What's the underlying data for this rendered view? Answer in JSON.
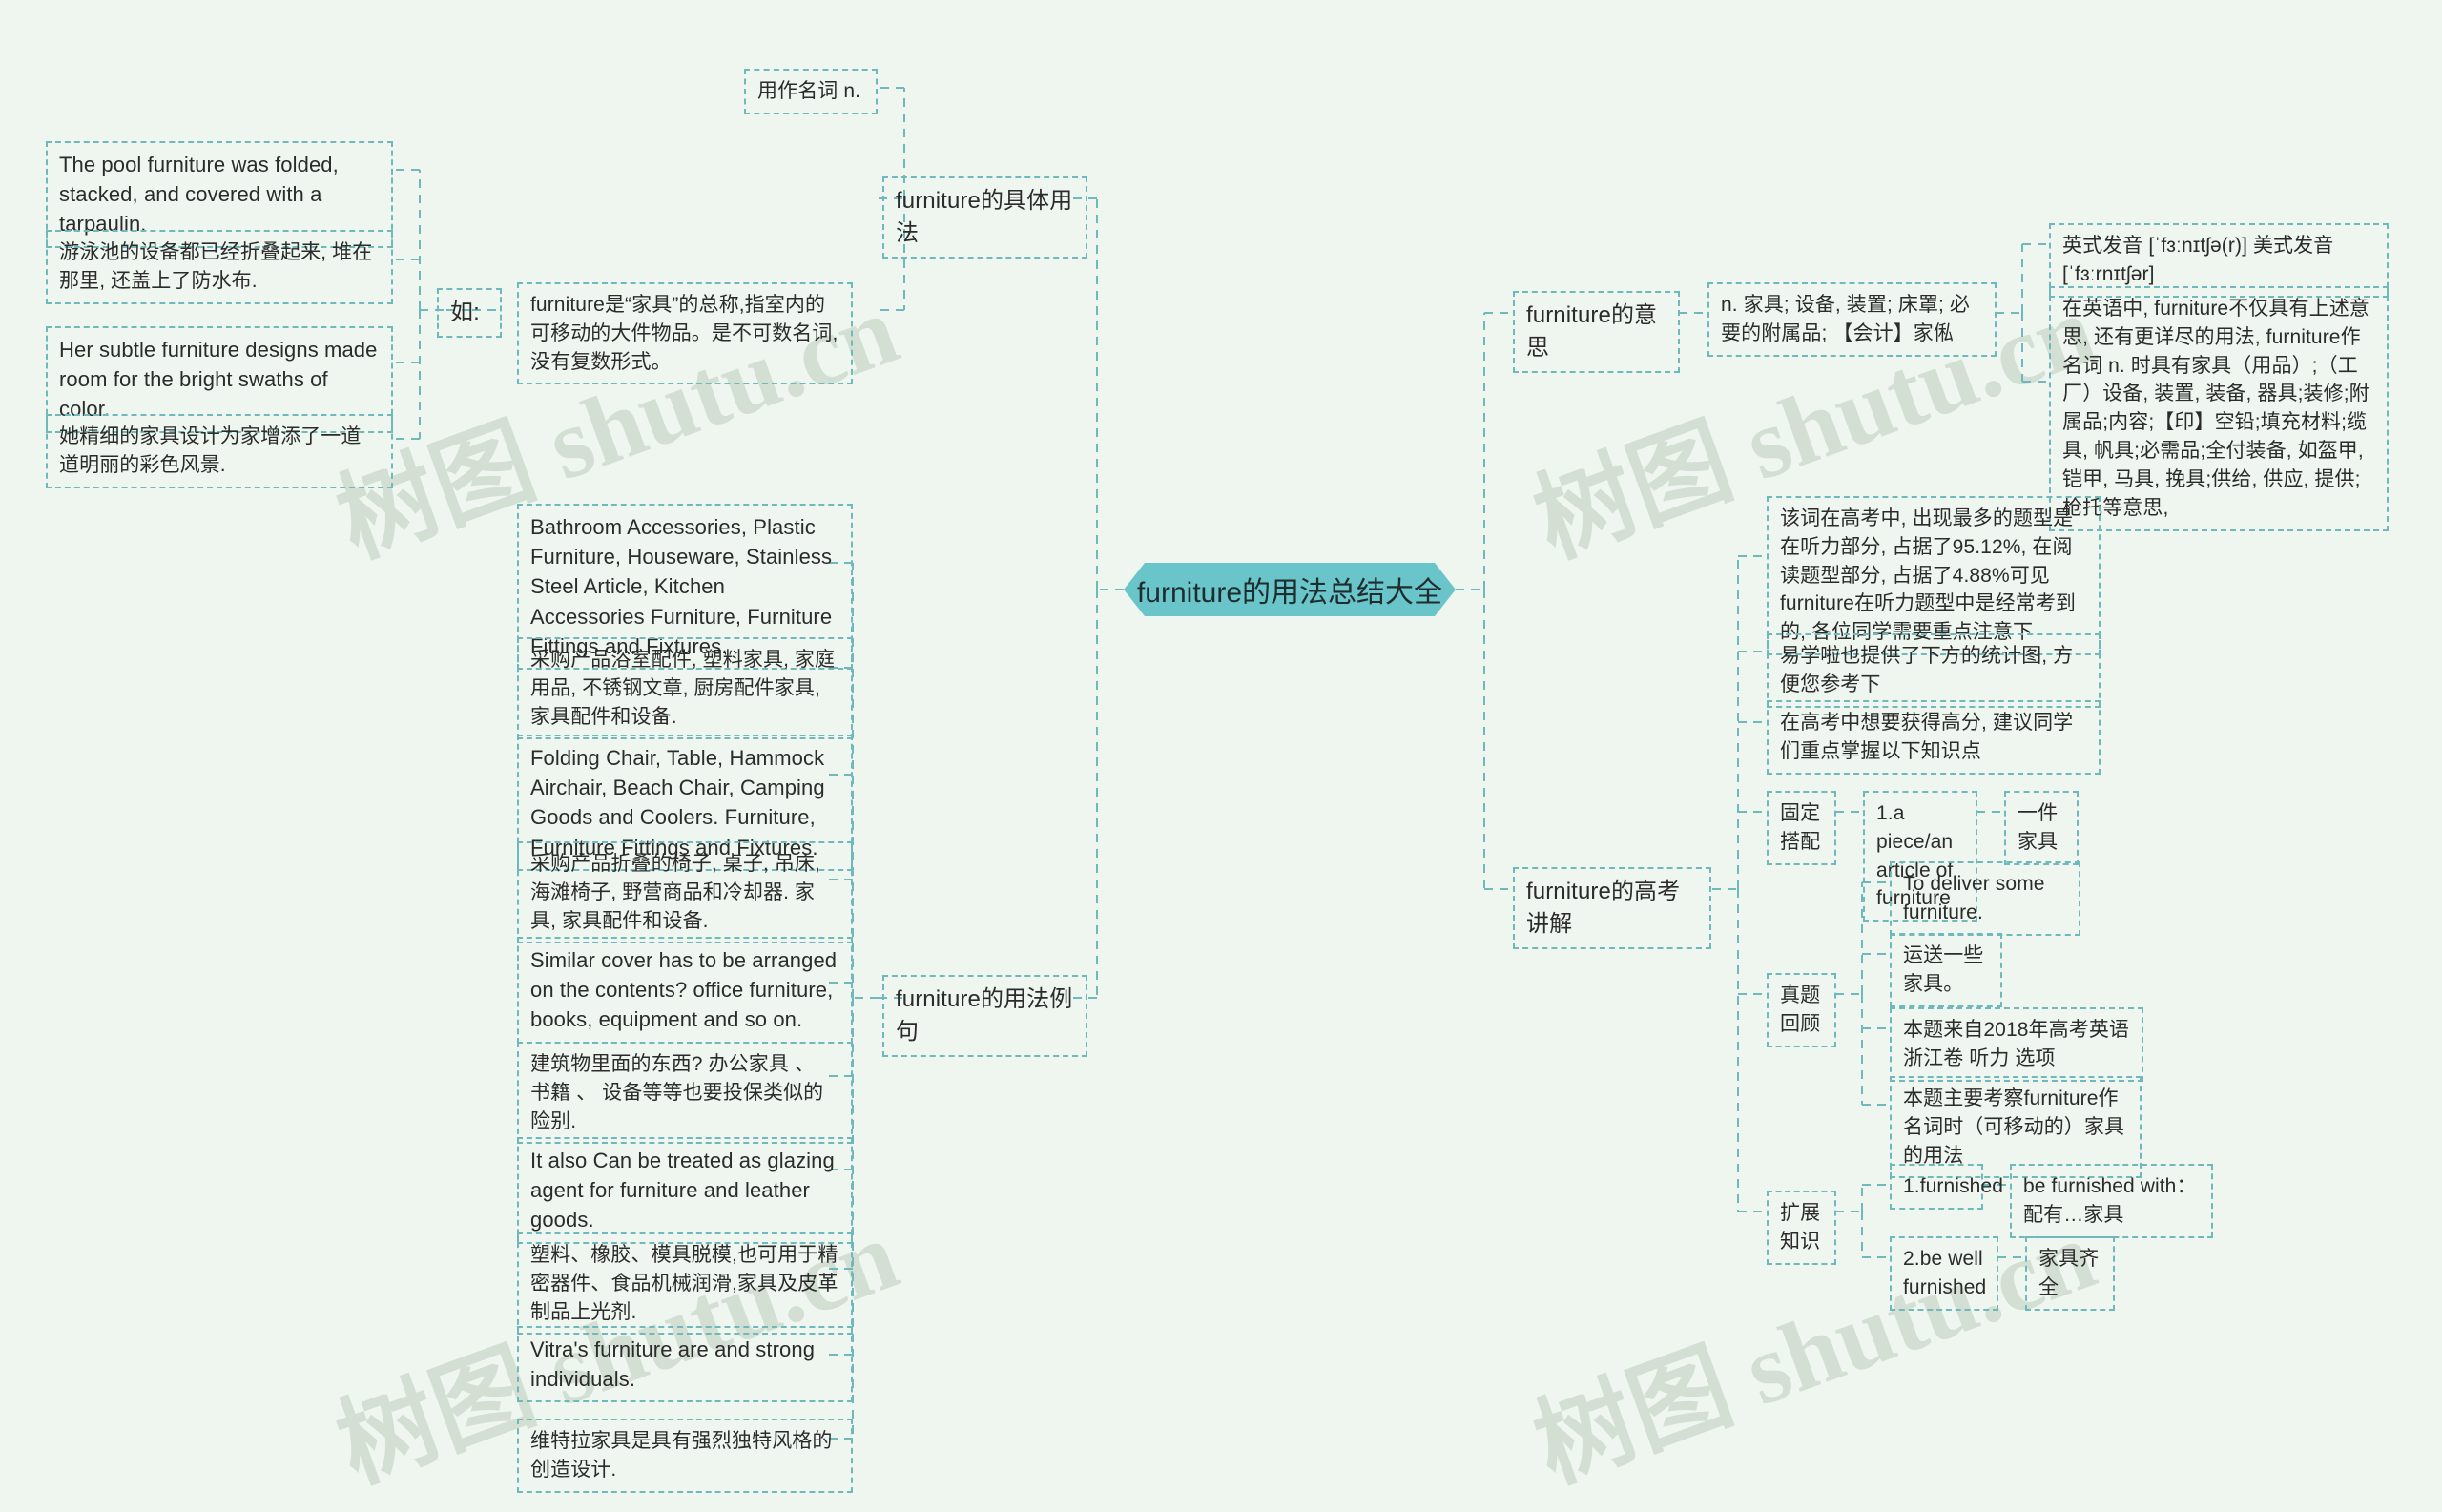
{
  "root": {
    "label": "furniture的用法总结大全",
    "color": "#69c5c9"
  },
  "watermark": {
    "text": "树图 shutu.cn"
  },
  "theme": {
    "background": "#eef6ef",
    "node_border": "#6fb9bd",
    "text": "#2b2b2b"
  },
  "branches": {
    "usage_detail": {
      "label": "furniture的具体用法",
      "children": [
        {
          "label": "用作名词 n."
        }
      ],
      "example_group": {
        "label": "如:",
        "definition": "furniture是“家具”的总称,指室内的可移动的大件物品。是不可数名词,没有复数形式。",
        "examples": [
          "The pool furniture was folded, stacked, and covered with a tarpaulin.",
          "游泳池的设备都已经折叠起来, 堆在那里, 还盖上了防水布.",
          "Her subtle furniture designs made room for the bright swaths of color.",
          "她精细的家具设计为家增添了一道道明丽的彩色风景."
        ]
      }
    },
    "usage_examples": {
      "label": "furniture的用法例句",
      "items": [
        "Bathroom Accessories, Plastic Furniture, Houseware, Stainless Steel Article, Kitchen Accessories Furniture, Furniture Fittings and Fixtures.",
        "采购产品浴室配件, 塑料家具, 家庭用品, 不锈钢文章, 厨房配件家具, 家具配件和设备.",
        "Folding Chair, Table, Hammock Airchair, Beach Chair, Camping Goods and Coolers. Furniture, Furniture Fittings and Fixtures.",
        "采购产品折叠的椅子, 桌子, 吊床, 海滩椅子, 野营商品和冷却器. 家具, 家具配件和设备.",
        "Similar cover has to be arranged on the contents? office furniture, books, equipment and so on.",
        "建筑物里面的东西? 办公家具 、 书籍 、 设备等等也要投保类似的险别.",
        "It also Can be treated as glazing agent for furniture and leather goods.",
        "塑料、橡胶、模具脱模,也可用于精密器件、食品机械润滑,家具及皮革制品上光剂.",
        "Vitra's furniture are and strong individuals.",
        "维特拉家具是具有强烈独特风格的创造设计."
      ]
    },
    "meaning": {
      "label": "furniture的意思",
      "definition": "n. 家具; 设备, 装置; 床罩; 必要的附属品; 【会计】家俬",
      "pronunciation": "英式发音 [ˈfɜːnɪtʃə(r)] 美式发音 [ˈfɜːrnɪtʃər]",
      "detail": "在英语中, furniture不仅具有上述意思, 还有更详尽的用法, furniture作名词 n. 时具有家具（用品）;（工厂）设备, 装置, 装备, 器具;装修;附属品;内容;【印】空铅;填充材料;缆具, 帆具;必需品;全付装备, 如盔甲, 铠甲, 马具, 挽具;供给, 供应, 提供;枪托等意思,"
    },
    "gaokao": {
      "label": "furniture的高考讲解",
      "notes": [
        "该词在高考中, 出现最多的题型是在听力部分, 占据了95.12%, 在阅读题型部分, 占据了4.88%可见furniture在听力题型中是经常考到的, 各位同学需要重点注意下",
        "易学啦也提供了下方的统计图, 方便您参考下",
        "在高考中想要获得高分, 建议同学们重点掌握以下知识点"
      ],
      "groups": [
        {
          "label": "固定搭配",
          "rows": [
            {
              "term": "1.a piece/an article of furniture",
              "trans": "一件家具"
            }
          ]
        },
        {
          "label": "真题回顾",
          "items": [
            "To deliver some furniture.",
            "运送一些家具。",
            "本题来自2018年高考英语浙江卷 听力 选项",
            "本题主要考察furniture作名词时（可移动的）家具的用法"
          ]
        },
        {
          "label": "扩展知识",
          "rows": [
            {
              "term": "1.furnished",
              "trans": "be furnished with：配有…家具"
            },
            {
              "term": "2.be well furnished",
              "trans": "家具齐全"
            }
          ]
        }
      ]
    }
  }
}
